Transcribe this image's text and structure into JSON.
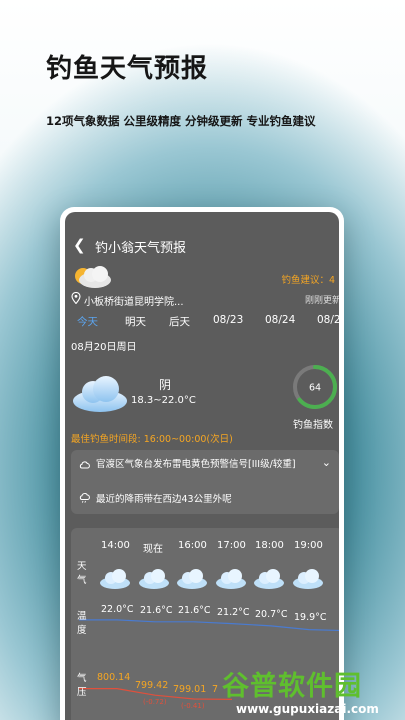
{
  "hero": {
    "title": "钓鱼天气预报",
    "subtitle": "12项气象数据  公里级精度  分钟级更新  专业钓鱼建议"
  },
  "app": {
    "header_title": "钓小翁天气预报",
    "advice_label": "钓鱼建议：4",
    "location": "小板桥街道昆明学院...",
    "updated": "刚刚更新",
    "tabs": [
      "今天",
      "明天",
      "后天",
      "08/23",
      "08/24",
      "08/2"
    ],
    "active_tab_index": 0,
    "date": "08月20日周日",
    "weather": {
      "condition": "阴",
      "temp_range": "18.3~22.0°C",
      "fishing_index": "64",
      "fishing_index_value": 64,
      "fishing_index_label": "钓鱼指数"
    },
    "best_time": "最佳钓鱼时间段:  16:00~00:00(次日)",
    "alerts": {
      "warning": "官渡区气象台发布雷电黄色预警信号[III级/较重]",
      "rain": "最近的降雨带在西边43公里外呢"
    },
    "hourly": {
      "row_labels": {
        "weather": "天气",
        "temp": "温度",
        "pressure": "气压"
      },
      "times": [
        "14:00",
        "现在",
        "16:00",
        "17:00",
        "18:00",
        "19:00"
      ],
      "temps": [
        "22.0°C",
        "21.6°C",
        "21.6°C",
        "21.2°C",
        "20.7°C",
        "19.9°C"
      ],
      "pressures": [
        "800.14",
        "799.42",
        "799.01",
        "7"
      ],
      "pressure_deltas": [
        "(-0.72)",
        "(-0.41)"
      ]
    }
  },
  "watermark": {
    "main": "谷普软件园",
    "url": "www.gupuxiazai.com"
  },
  "colors": {
    "accent_orange": "#f5a623",
    "tab_active": "#5ba5f0",
    "gauge": "#4caf50",
    "screen_bg": "#5c5c5c"
  }
}
